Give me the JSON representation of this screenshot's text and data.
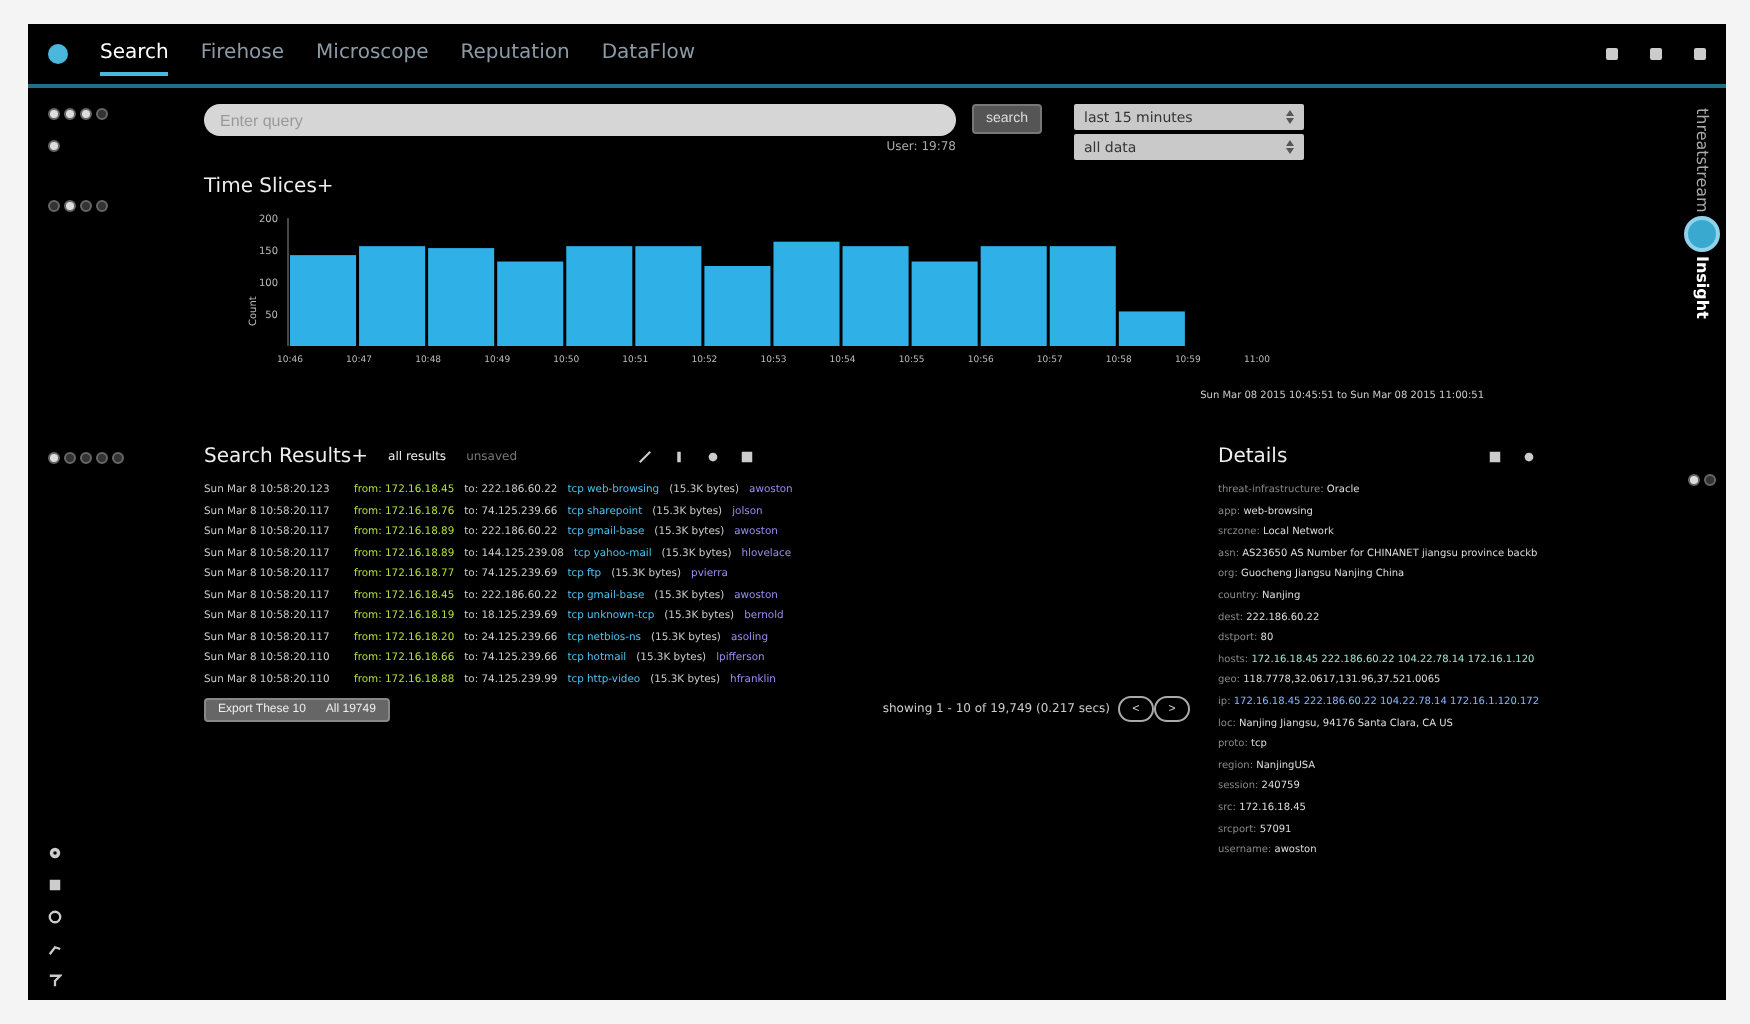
{
  "nav": {
    "tabs": [
      {
        "label": "Search",
        "selected": true
      },
      {
        "label": "Firehose",
        "selected": false
      },
      {
        "label": "Microscope",
        "selected": false
      },
      {
        "label": "Reputation",
        "selected": false
      },
      {
        "label": "DataFlow",
        "selected": false
      }
    ]
  },
  "search": {
    "placeholder": "Enter query",
    "hint": "User: 19:78",
    "button": "search",
    "range": "last 15 minutes",
    "scope": "all data"
  },
  "brand": {
    "top": "threatstream",
    "bottom": "Insight"
  },
  "time_slices": {
    "title": "Time Slices+",
    "subtitle": "Sun Mar 08 2015 10:45:51 to Sun Mar 08 2015 11:00:51",
    "chart_data": {
      "type": "bar",
      "ylabel": "Count",
      "categories": [
        "10:46",
        "10:47",
        "10:48",
        "10:49",
        "10:50",
        "10:51",
        "10:52",
        "10:53",
        "10:54",
        "10:55",
        "10:56",
        "10:57",
        "10:58",
        "10:59",
        "11:00"
      ],
      "values": [
        142,
        156,
        153,
        132,
        156,
        156,
        125,
        163,
        156,
        132,
        156,
        156,
        54,
        null,
        null
      ],
      "ylim": [
        0,
        200
      ],
      "yticks": [
        50,
        100,
        150,
        200
      ]
    }
  },
  "results": {
    "title": "Search Results+",
    "filters": [
      {
        "label": "all results",
        "selected": true
      },
      {
        "label": "unsaved",
        "selected": false
      }
    ],
    "rows": [
      {
        "time": "Sun Mar 8 10:58:20.123",
        "from": "from: 172.16.18.45",
        "to": "to: 222.186.60.22",
        "app": "tcp web-browsing",
        "bytes": "(15.3K bytes)",
        "user": "awoston"
      },
      {
        "time": "Sun Mar 8 10:58:20.117",
        "from": "from: 172.16.18.76",
        "to": "to: 74.125.239.66",
        "app": "tcp sharepoint",
        "bytes": "(15.3K bytes)",
        "user": "jolson"
      },
      {
        "time": "Sun Mar 8 10:58:20.117",
        "from": "from: 172.16.18.89",
        "to": "to: 222.186.60.22",
        "app": "tcp gmail-base",
        "bytes": "(15.3K bytes)",
        "user": "awoston"
      },
      {
        "time": "Sun Mar 8 10:58:20.117",
        "from": "from: 172.16.18.89",
        "to": "to: 144.125.239.08",
        "app": "tcp yahoo-mail",
        "bytes": "(15.3K bytes)",
        "user": "hlovelace"
      },
      {
        "time": "Sun Mar 8 10:58:20.117",
        "from": "from: 172.16.18.77",
        "to": "to: 74.125.239.69",
        "app": "tcp ftp",
        "bytes": "(15.3K bytes)",
        "user": "pvierra"
      },
      {
        "time": "Sun Mar 8 10:58:20.117",
        "from": "from: 172.16.18.45",
        "to": "to: 222.186.60.22",
        "app": "tcp gmail-base",
        "bytes": "(15.3K bytes)",
        "user": "awoston"
      },
      {
        "time": "Sun Mar 8 10:58:20.117",
        "from": "from: 172.16.18.19",
        "to": "to: 18.125.239.69",
        "app": "tcp unknown-tcp",
        "bytes": "(15.3K bytes)",
        "user": "bernold"
      },
      {
        "time": "Sun Mar 8 10:58:20.117",
        "from": "from: 172.16.18.20",
        "to": "to: 24.125.239.66",
        "app": "tcp netbios-ns",
        "bytes": "(15.3K bytes)",
        "user": "asoling"
      },
      {
        "time": "Sun Mar 8 10:58:20.110",
        "from": "from: 172.16.18.66",
        "to": "to: 74.125.239.66",
        "app": "tcp hotmail",
        "bytes": "(15.3K bytes)",
        "user": "lpifferson"
      },
      {
        "time": "Sun Mar 8 10:58:20.110",
        "from": "from: 172.16.18.88",
        "to": "to: 74.125.239.99",
        "app": "tcp http-video",
        "bytes": "(15.3K bytes)",
        "user": "hfranklin"
      }
    ],
    "export": "Export These 10",
    "export_all": "All 19749",
    "showing": "showing 1 - 10 of 19,749 (0.217 secs)",
    "prev": "<",
    "next": ">"
  },
  "details": {
    "title": "Details",
    "fields": [
      {
        "key": "threat-infrastructure:",
        "value": "Oracle",
        "kind": "plain"
      },
      {
        "key": "app:",
        "value": "web-browsing",
        "kind": "plain"
      },
      {
        "key": "srczone:",
        "value": "Local Network",
        "kind": "plain"
      },
      {
        "key": "asn:",
        "value": "AS23650 AS Number for CHINANET jiangsu province backb",
        "kind": "plain"
      },
      {
        "key": "org:",
        "value": "Guocheng Jiangsu Nanjing China",
        "kind": "plain"
      },
      {
        "key": "country:",
        "value": "Nanjing",
        "kind": "plain"
      },
      {
        "key": "dest:",
        "value": "222.186.60.22",
        "kind": "plain"
      },
      {
        "key": "dstport:",
        "value": "80",
        "kind": "plain"
      },
      {
        "key": "hosts:",
        "value": "172.16.18.45 222.186.60.22 104.22.78.14 172.16.1.120",
        "kind": "accent"
      },
      {
        "key": "geo:",
        "value": "118.7778,32.0617,131.96,37.521.0065",
        "kind": "plain"
      },
      {
        "key": "ip:",
        "value": "172.16.18.45 222.186.60.22 104.22.78.14 172.16.1.120.172",
        "kind": "link"
      },
      {
        "key": "loc:",
        "value": "Nanjing Jiangsu, 94176 Santa Clara, CA US",
        "kind": "plain"
      },
      {
        "key": "proto:",
        "value": "tcp",
        "kind": "plain"
      },
      {
        "key": "region:",
        "value": "NanjingUSA",
        "kind": "plain"
      },
      {
        "key": "session:",
        "value": "240759",
        "kind": "plain"
      },
      {
        "key": "src:",
        "value": "172.16.18.45",
        "kind": "plain"
      },
      {
        "key": "srcport:",
        "value": "57091",
        "kind": "plain"
      },
      {
        "key": "username:",
        "value": "awoston",
        "kind": "plain"
      }
    ]
  }
}
